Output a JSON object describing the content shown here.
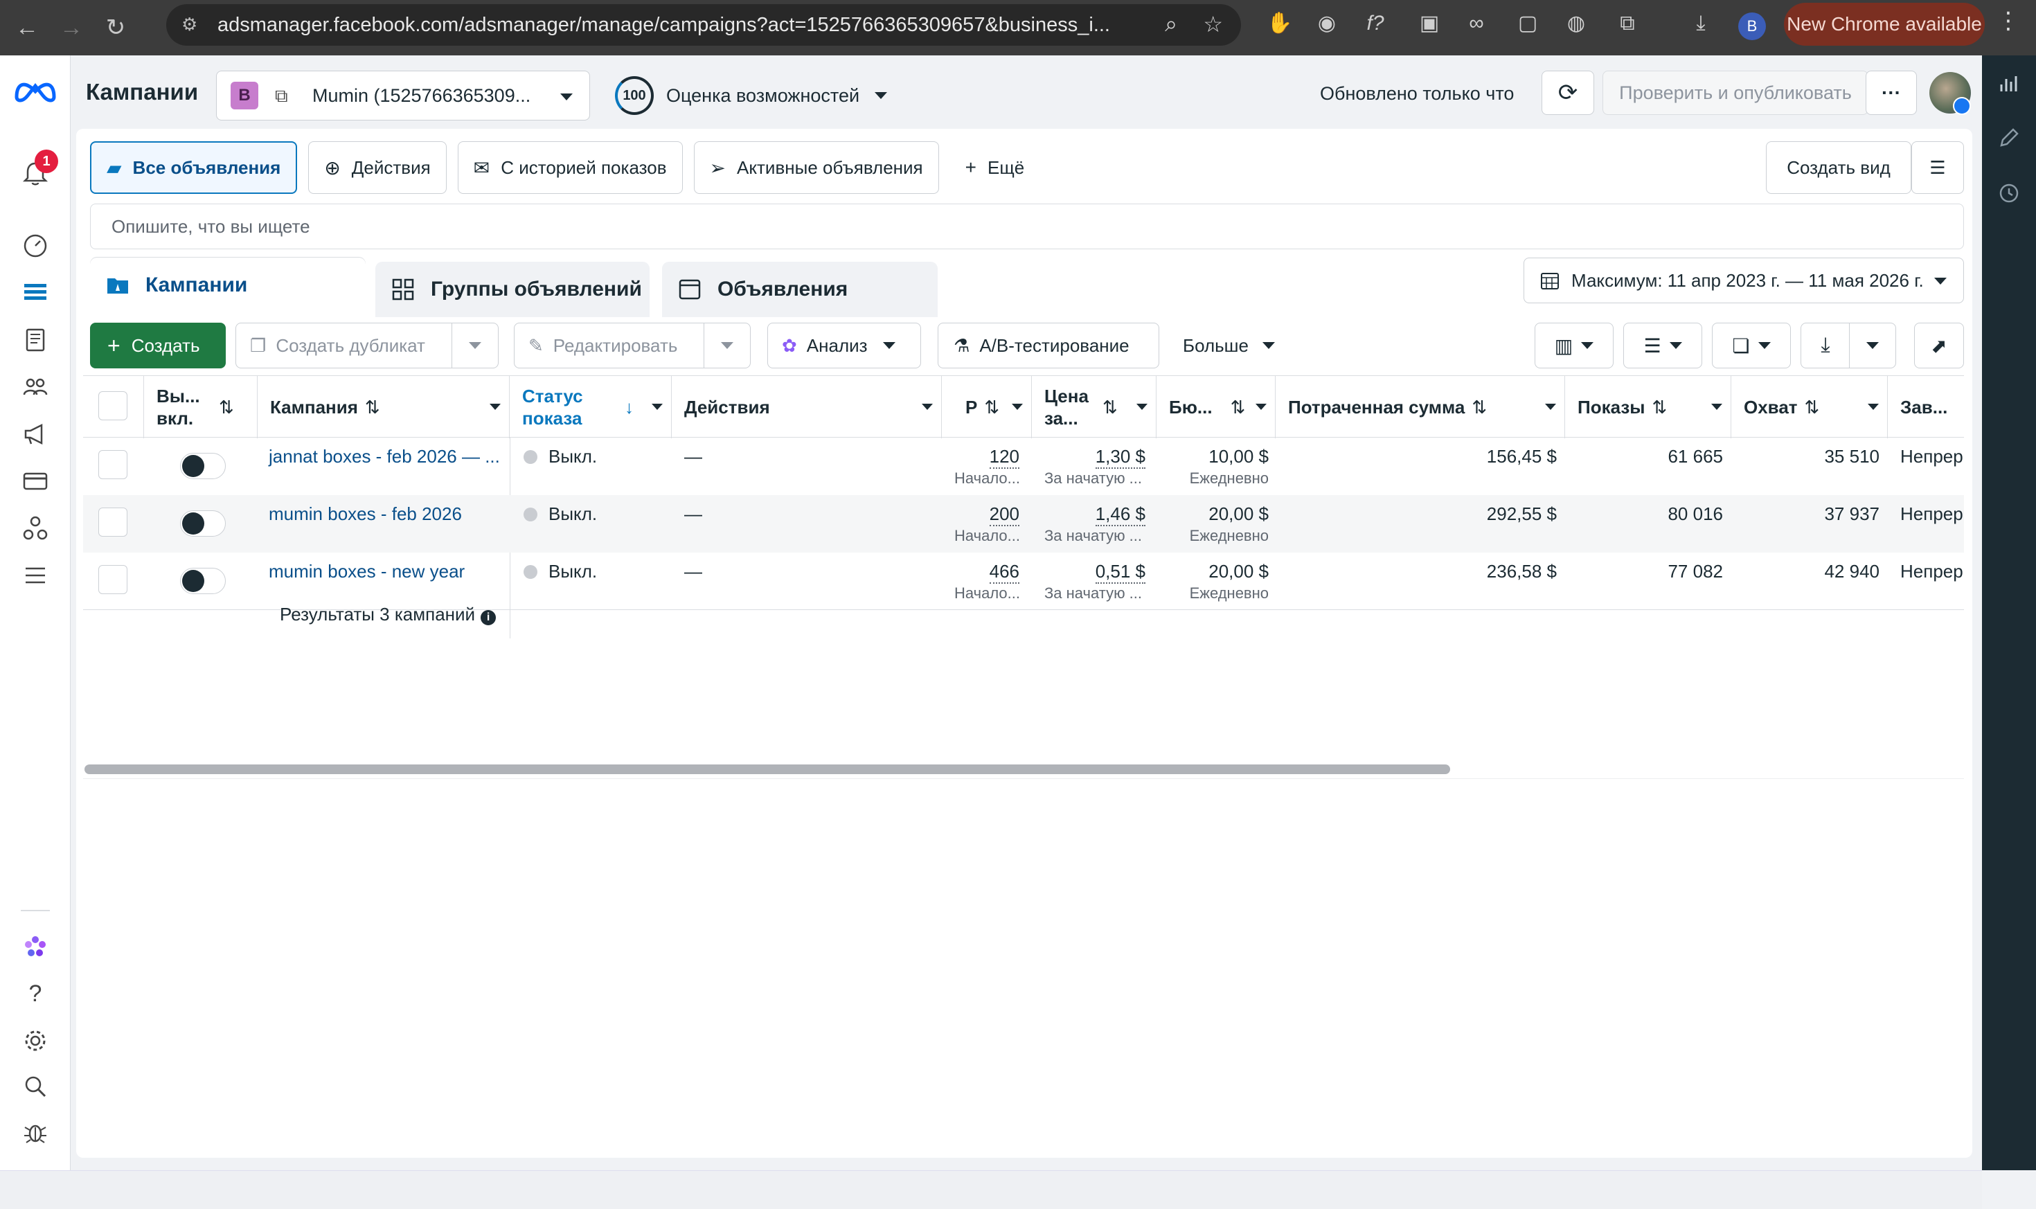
{
  "browser": {
    "url": "adsmanager.facebook.com/adsmanager/manage/campaigns?act=1525766365309657&business_i...",
    "profile_initial": "B",
    "update_label": "New Chrome available"
  },
  "nav": {
    "notifications_count": "1"
  },
  "header": {
    "title": "Кампании",
    "account_badge": "B",
    "account_name": "Mumin (1525766365309...",
    "score_value": "100",
    "score_label": "Оценка возможностей",
    "updated_text": "Обновлено только что",
    "publish_label": "Проверить и опубликовать",
    "more_label": "···"
  },
  "filters": {
    "items": [
      {
        "label": "Все объявления",
        "icon": "folder-icon"
      },
      {
        "label": "Действия",
        "icon": "upload-circle-icon"
      },
      {
        "label": "С историей показов",
        "icon": "envelope-open-icon"
      },
      {
        "label": "Активные объявления",
        "icon": "send-icon"
      },
      {
        "label": "Ещё",
        "icon": "plus-icon"
      }
    ],
    "create_view_label": "Создать вид",
    "search_placeholder": "Опишите, что вы ищете"
  },
  "tabs": [
    {
      "label": "Кампании",
      "icon": "folder-flag-icon"
    },
    {
      "label": "Группы объявлений",
      "icon": "grid-icon"
    },
    {
      "label": "Объявления",
      "icon": "ad-square-icon"
    }
  ],
  "date_range": "Максимум: 11 апр 2023 г. — 11 мая 2026 г.",
  "toolbar": {
    "create": "Создать",
    "duplicate": "Создать дубликат",
    "edit": "Редактировать",
    "analyze": "Анализ",
    "ab_test": "A/B-тестирование",
    "more": "Больше"
  },
  "table": {
    "columns": {
      "onoff": "Вы... вкл.",
      "campaign": "Кампания",
      "status": "Статус показа",
      "actions": "Действия",
      "results": "Р",
      "cost": "Цена за...",
      "budget": "Бю...",
      "spent": "Потраченная сумма",
      "impressions": "Показы",
      "reach": "Охват",
      "ends": "Зав..."
    },
    "rows": [
      {
        "campaign": "jannat boxes - feb 2026 — ...",
        "status": "Выкл.",
        "actions": "—",
        "results": "120",
        "results_sub": "Начало...",
        "cost": "1,30 $",
        "cost_sub": "За начатую ...",
        "budget": "10,00 $",
        "budget_sub": "Ежедневно",
        "spent": "156,45 $",
        "impressions": "61 665",
        "reach": "35 510",
        "ends": "Непрер"
      },
      {
        "campaign": "mumin boxes - feb 2026",
        "status": "Выкл.",
        "actions": "—",
        "results": "200",
        "results_sub": "Начало...",
        "cost": "1,46 $",
        "cost_sub": "За начатую ...",
        "budget": "20,00 $",
        "budget_sub": "Ежедневно",
        "spent": "292,55 $",
        "impressions": "80 016",
        "reach": "37 937",
        "ends": "Непрер"
      },
      {
        "campaign": "mumin boxes - new year",
        "status": "Выкл.",
        "actions": "—",
        "results": "466",
        "results_sub": "Начало...",
        "cost": "0,51 $",
        "cost_sub": "За начатую ...",
        "budget": "20,00 $",
        "budget_sub": "Ежедневно",
        "spent": "236,58 $",
        "impressions": "77 082",
        "reach": "42 940",
        "ends": "Непрер"
      }
    ],
    "summary": "Результаты 3 кампаний"
  },
  "colors": {
    "accent": "#0a78be",
    "create_green": "#1f7a42",
    "nav_dark": "#1c2b33"
  }
}
